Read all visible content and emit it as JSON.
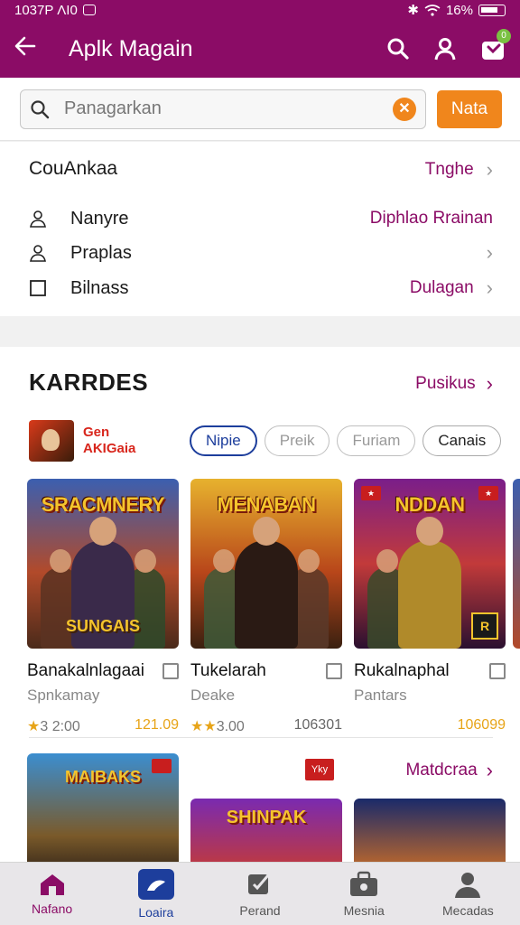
{
  "status": {
    "time": "1037P ΛI0",
    "battery": "16%"
  },
  "appbar": {
    "title": "Aplk Magain",
    "cart_count": "0"
  },
  "search": {
    "placeholder": "Panagarkan",
    "button_label": "Nata"
  },
  "category": {
    "title": "CouAnkaa",
    "link": "Tnghe",
    "rows": [
      {
        "label": "Nanyre",
        "value": "Diphlao Rrainan",
        "icon": "person-icon"
      },
      {
        "label": "Praplas",
        "value": "",
        "icon": "person-icon"
      },
      {
        "label": "Bilnass",
        "value": "Dulagan",
        "icon": "checkbox-icon"
      }
    ]
  },
  "games": {
    "title": "KARRDES",
    "link": "Pusikus",
    "brand": {
      "line1": "Gen",
      "line2": "AKIGaia"
    },
    "chips": [
      "Nipie",
      "Preik",
      "Furiam",
      "Canais"
    ],
    "cards": [
      {
        "art_title": "SRACMNERY",
        "art_sub": "SUNGAIS",
        "name": "Banakalnlagaai",
        "sub": "Spnkamay",
        "rating": "3 2:00",
        "price": "121.09"
      },
      {
        "art_title": "MENABAN",
        "art_sub": "",
        "name": "Tukelarah",
        "sub": "Deake",
        "rating": "3.00",
        "price": "106301"
      },
      {
        "art_title": "NDDAN",
        "art_sub": "",
        "name": "Rukalnaphal",
        "sub": "Pantars",
        "rating": "",
        "price": "106099"
      }
    ],
    "row2_link": "Matdcraa",
    "row2_tag": "Yky",
    "row2_cards": [
      "MAIBAKS",
      "SHINPAK",
      ""
    ],
    "colors": {
      "accent": "#8b0c66",
      "orange": "#f0861c",
      "gold": "#e7a418"
    }
  },
  "bottom_nav": [
    {
      "label": "Nafano",
      "icon": "home-icon"
    },
    {
      "label": "Loaira",
      "icon": "library-icon"
    },
    {
      "label": "Perand",
      "icon": "edit-icon"
    },
    {
      "label": "Mesnia",
      "icon": "briefcase-icon"
    },
    {
      "label": "Mecadas",
      "icon": "profile-icon"
    }
  ]
}
